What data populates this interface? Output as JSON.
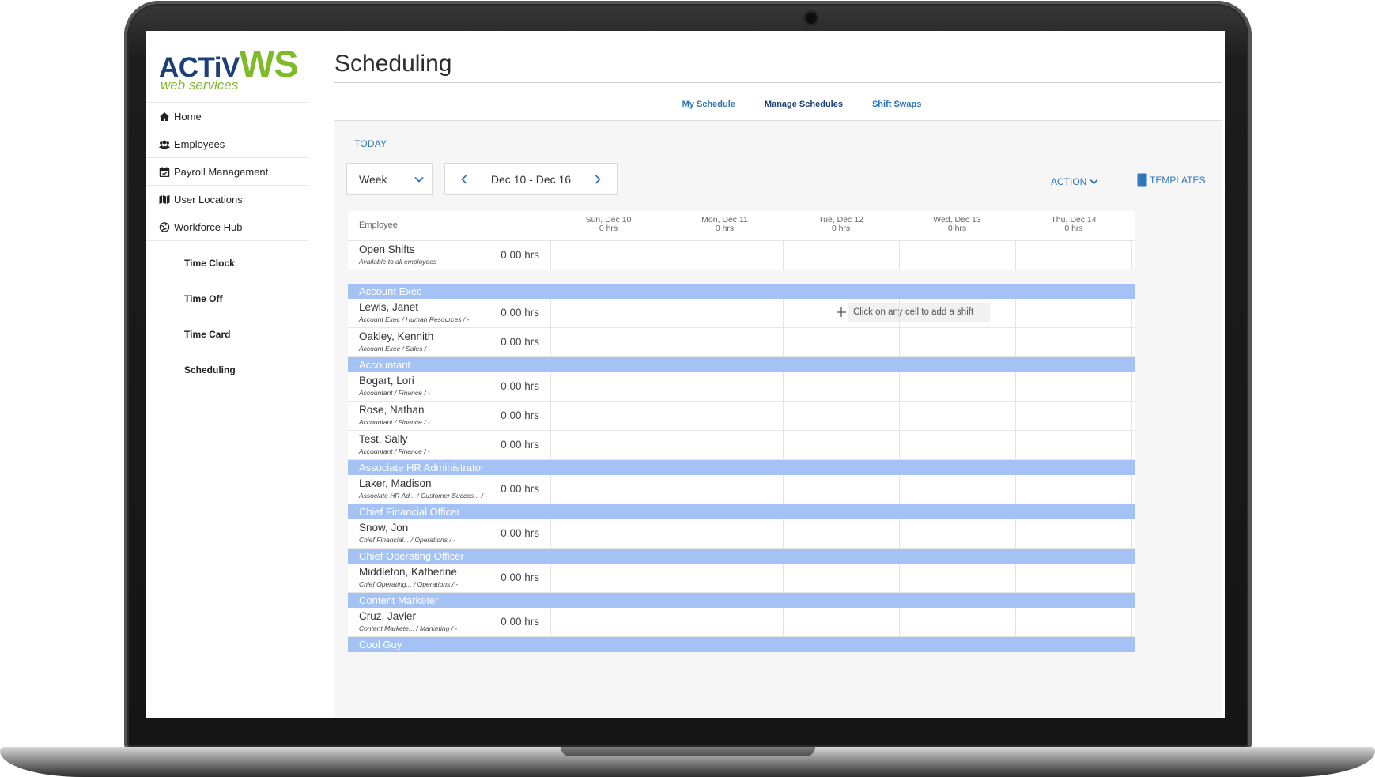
{
  "logo": {
    "brand_a": "ACTiV",
    "brand_b": "WS",
    "tagline": "web services"
  },
  "sidebar": {
    "items": [
      {
        "label": "Home",
        "icon": "home-icon"
      },
      {
        "label": "Employees",
        "icon": "users-icon"
      },
      {
        "label": "Payroll Management",
        "icon": "calendar-check-icon"
      },
      {
        "label": "User Locations",
        "icon": "map-icon"
      },
      {
        "label": "Workforce Hub",
        "icon": "globe-icon"
      }
    ],
    "sub_items": [
      "Time Clock",
      "Time Off",
      "Time Card",
      "Scheduling"
    ]
  },
  "page": {
    "title": "Scheduling"
  },
  "subnav": {
    "my_schedule": "My Schedule",
    "manage_schedules": "Manage Schedules",
    "shift_swaps": "Shift Swaps"
  },
  "toolbar": {
    "today": "TODAY",
    "view": "Week",
    "date_range": "Dec 10 - Dec 16",
    "action": "ACTION",
    "templates": "TEMPLATES"
  },
  "grid": {
    "employee_header": "Employee",
    "days": [
      {
        "label": "Sun, Dec 10",
        "hours": "0 hrs"
      },
      {
        "label": "Mon, Dec 11",
        "hours": "0 hrs"
      },
      {
        "label": "Tue, Dec 12",
        "hours": "0 hrs"
      },
      {
        "label": "Wed, Dec 13",
        "hours": "0 hrs"
      },
      {
        "label": "Thu, Dec 14",
        "hours": "0 hrs"
      }
    ],
    "open_shifts": {
      "name": "Open Shifts",
      "meta": "Available to all employees",
      "hours": "0.00 hrs"
    },
    "hint": "Click on any cell to add a shift",
    "groups": [
      {
        "title": "Account Exec",
        "employees": [
          {
            "name": "Lewis, Janet",
            "meta": "Account Exec / Human Resources / -",
            "hours": "0.00 hrs"
          },
          {
            "name": "Oakley, Kennith",
            "meta": "Account Exec / Sales / -",
            "hours": "0.00 hrs"
          }
        ]
      },
      {
        "title": "Accountant",
        "employees": [
          {
            "name": "Bogart, Lori",
            "meta": "Accountant / Finance / -",
            "hours": "0.00 hrs"
          },
          {
            "name": "Rose, Nathan",
            "meta": "Accountant / Finance / -",
            "hours": "0.00 hrs"
          },
          {
            "name": "Test, Sally",
            "meta": "Accountant / Finance / -",
            "hours": "0.00 hrs"
          }
        ]
      },
      {
        "title": "Associate HR Administrator",
        "employees": [
          {
            "name": "Laker, Madison",
            "meta": "Associate HR Ad... / Customer Succes... / -",
            "hours": "0.00 hrs"
          }
        ]
      },
      {
        "title": "Chief Financial Officer",
        "employees": [
          {
            "name": "Snow, Jon",
            "meta": "Chief Financial... / Operations / -",
            "hours": "0.00 hrs"
          }
        ]
      },
      {
        "title": "Chief Operating Officer",
        "employees": [
          {
            "name": "Middleton, Katherine",
            "meta": "Chief Operating... / Operations / -",
            "hours": "0.00 hrs"
          }
        ]
      },
      {
        "title": "Content Marketer",
        "employees": [
          {
            "name": "Cruz, Javier",
            "meta": "Content Markete... / Marketing / -",
            "hours": "0.00 hrs"
          }
        ]
      },
      {
        "title": "Cool Guy",
        "employees": []
      }
    ]
  },
  "colors": {
    "accent": "#2d74b8",
    "brand_navy": "#1c3f78",
    "brand_green": "#7fba2a",
    "group_bar": "#a4c2f4"
  }
}
